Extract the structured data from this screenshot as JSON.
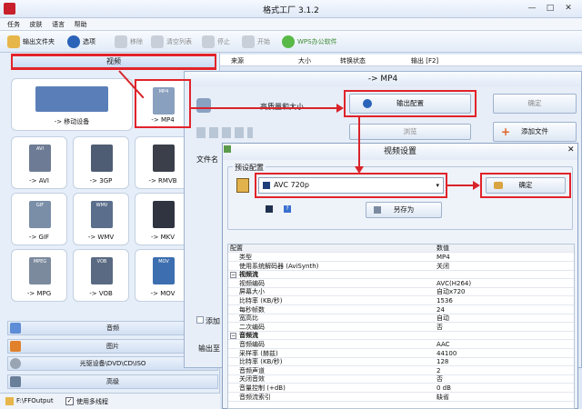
{
  "window": {
    "title": "格式工厂 3.1.2",
    "minimize": "—",
    "maximize": "□",
    "close": "✕"
  },
  "menu": [
    "任务",
    "皮肤",
    "语言",
    "帮助"
  ],
  "toolbar": {
    "output_folder": "输出文件夹",
    "options": "选项",
    "remove": "移除",
    "clear_list": "清空列表",
    "stop": "停止",
    "start": "开始",
    "wps": "WPS办公软件"
  },
  "left": {
    "video_header": "视频",
    "tiles": [
      {
        "label": "-> 移动设备",
        "icon": "mobile-devices-icon"
      },
      {
        "label": "-> MP4",
        "icon": "mp4-file-icon",
        "badge": "MP4"
      },
      {
        "label": "-> AVI",
        "icon": "avi-file-icon",
        "badge": "AVI"
      },
      {
        "label": "-> 3GP",
        "icon": "3gp-phone-icon"
      },
      {
        "label": "-> RMVB",
        "icon": "rmvb-film-icon"
      },
      {
        "label": "-> GIF",
        "icon": "gif-file-icon",
        "badge": "GIF"
      },
      {
        "label": "-> WMV",
        "icon": "wmv-file-icon",
        "badge": "WMV"
      },
      {
        "label": "-> MKV",
        "icon": "mkv-file-icon"
      },
      {
        "label": "-> MPG",
        "icon": "mpg-file-icon",
        "badge": "MPEG"
      },
      {
        "label": "-> VOB",
        "icon": "vob-file-icon",
        "badge": "VOB"
      },
      {
        "label": "-> MOV",
        "icon": "mov-file-icon",
        "badge": "MOV"
      }
    ],
    "categories": [
      "音频",
      "图片",
      "光驱设备\\DVD\\CD\\ISO",
      "高级"
    ],
    "status_path": "F:\\FFOutput",
    "status_multithread": "使用多线程"
  },
  "list_header": {
    "source": "来源",
    "size": "大小",
    "status": "转换状态",
    "output": "输出 [F2]"
  },
  "mp4_dialog": {
    "title": "-> MP4",
    "quality_label": "高质量和大小",
    "output_config": "输出配置",
    "ok": "确定",
    "browse": "浏览",
    "add_file": "添加文件",
    "file_label": "文件名",
    "add_label": "添加",
    "output_label": "输出至"
  },
  "video_settings": {
    "title": "视频设置",
    "preset_group": "预设配置",
    "preset_value": "AVC 720p",
    "ok": "确定",
    "save_as": "另存为",
    "grid_headers": {
      "config": "配置",
      "value": "数值"
    },
    "rows": [
      {
        "k": "类型",
        "v": "MP4"
      },
      {
        "k": "使用系统解码器 (AviSynth)",
        "v": "关闭"
      },
      {
        "k": "视频流",
        "v": "",
        "section": true
      },
      {
        "k": "视频编码",
        "v": "AVC(H264)"
      },
      {
        "k": "屏幕大小",
        "v": "自动x720"
      },
      {
        "k": "比特率 (KB/秒)",
        "v": "1536"
      },
      {
        "k": "每秒帧数",
        "v": "24"
      },
      {
        "k": "宽高比",
        "v": "自动"
      },
      {
        "k": "二次编码",
        "v": "否"
      },
      {
        "k": "音频流",
        "v": "",
        "section": true
      },
      {
        "k": "音频编码",
        "v": "AAC"
      },
      {
        "k": "采样率 (赫兹)",
        "v": "44100"
      },
      {
        "k": "比特率 (KB/秒)",
        "v": "128"
      },
      {
        "k": "音频声道",
        "v": "2"
      },
      {
        "k": "关闭音效",
        "v": "否"
      },
      {
        "k": "音量控制 (+dB)",
        "v": "0 dB"
      },
      {
        "k": "音频流索引",
        "v": "缺省"
      }
    ]
  },
  "colors": {
    "accent_red": "#e2232a",
    "panel": "#e6eef9",
    "title_blue": "#2a63b8"
  }
}
